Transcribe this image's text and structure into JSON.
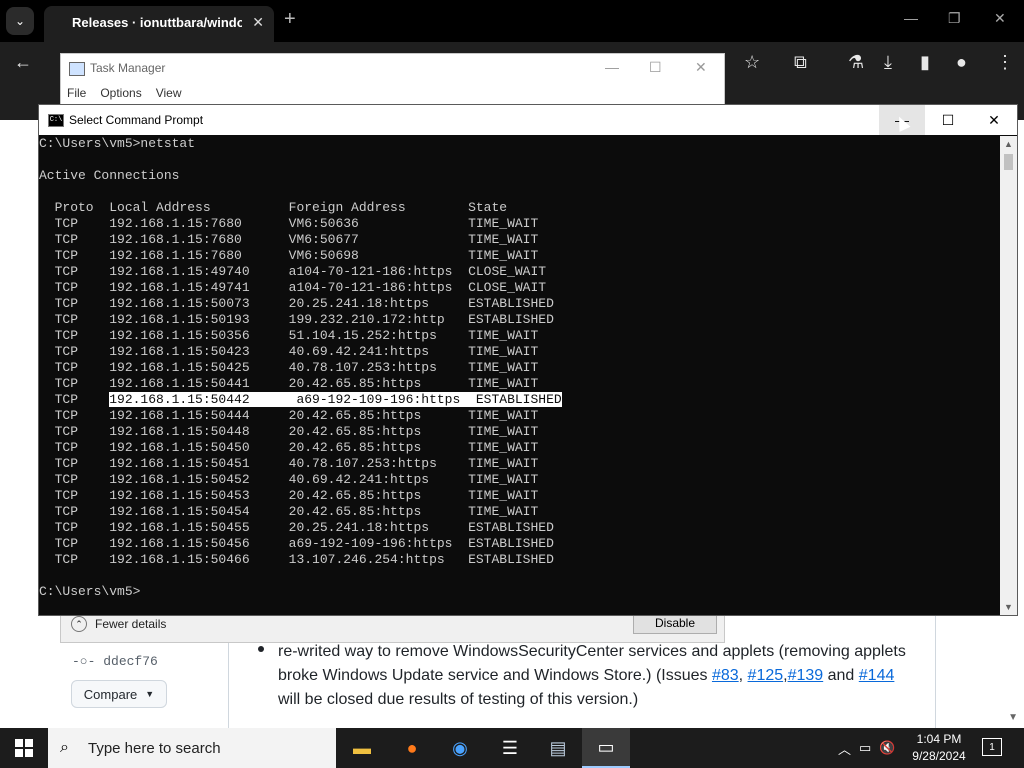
{
  "browser": {
    "tab_title": "Releases · ionuttbara/windows",
    "tab_close": "✕",
    "new_tab": "+",
    "dropdown": "⌄",
    "win_min": "—",
    "win_restore": "❐",
    "win_close": "✕"
  },
  "task_manager": {
    "title": "Task Manager",
    "menu": [
      "File",
      "Options",
      "View"
    ],
    "fewer_details": "Fewer details",
    "disable": "Disable"
  },
  "cmd": {
    "title": "Select Command Prompt",
    "lines": [
      "C:\\Users\\vm5>netstat",
      "",
      "Active Connections",
      "",
      "  Proto  Local Address          Foreign Address        State",
      "  TCP    192.168.1.15:7680      VM6:50636              TIME_WAIT",
      "  TCP    192.168.1.15:7680      VM6:50677              TIME_WAIT",
      "  TCP    192.168.1.15:7680      VM6:50698              TIME_WAIT",
      "  TCP    192.168.1.15:49740     a104-70-121-186:https  CLOSE_WAIT",
      "  TCP    192.168.1.15:49741     a104-70-121-186:https  CLOSE_WAIT",
      "  TCP    192.168.1.15:50073     20.25.241.18:https     ESTABLISHED",
      "  TCP    192.168.1.15:50193     199.232.210.172:http   ESTABLISHED",
      "  TCP    192.168.1.15:50356     51.104.15.252:https    TIME_WAIT",
      "  TCP    192.168.1.15:50423     40.69.42.241:https     TIME_WAIT",
      "  TCP    192.168.1.15:50425     40.78.107.253:https    TIME_WAIT",
      "  TCP    192.168.1.15:50441     20.42.65.85:https      TIME_WAIT"
    ],
    "selected_prefix": "  TCP    ",
    "selected_text": "192.168.1.15:50442      a69-192-109-196:https  ESTABLISHED",
    "lines_after": [
      "  TCP    192.168.1.15:50444     20.42.65.85:https      TIME_WAIT",
      "  TCP    192.168.1.15:50448     20.42.65.85:https      TIME_WAIT",
      "  TCP    192.168.1.15:50450     20.42.65.85:https      TIME_WAIT",
      "  TCP    192.168.1.15:50451     40.78.107.253:https    TIME_WAIT",
      "  TCP    192.168.1.15:50452     40.69.42.241:https     TIME_WAIT",
      "  TCP    192.168.1.15:50453     20.42.65.85:https      TIME_WAIT",
      "  TCP    192.168.1.15:50454     20.42.65.85:https      TIME_WAIT",
      "  TCP    192.168.1.15:50455     20.25.241.18:https     ESTABLISHED",
      "  TCP    192.168.1.15:50456     a69-192-109-196:https  ESTABLISHED",
      "  TCP    192.168.1.15:50466     13.107.246.254:https   ESTABLISHED",
      "",
      "C:\\Users\\vm5>"
    ]
  },
  "page": {
    "commit": "ddecf76",
    "compare_label": "Compare",
    "bullet_text_before": "re-writed way to remove WindowsSecurityCenter services and applets (removing applets broke Windows Update service and Windows Store.) (Issues ",
    "links": [
      "#83",
      "#125",
      "#139",
      "#144"
    ],
    "and_word": " and ",
    "bullet_text_after": " will be closed due results of testing of this version.)"
  },
  "taskbar": {
    "search_placeholder": "Type here to search",
    "time": "1:04 PM",
    "date": "9/28/2024"
  }
}
